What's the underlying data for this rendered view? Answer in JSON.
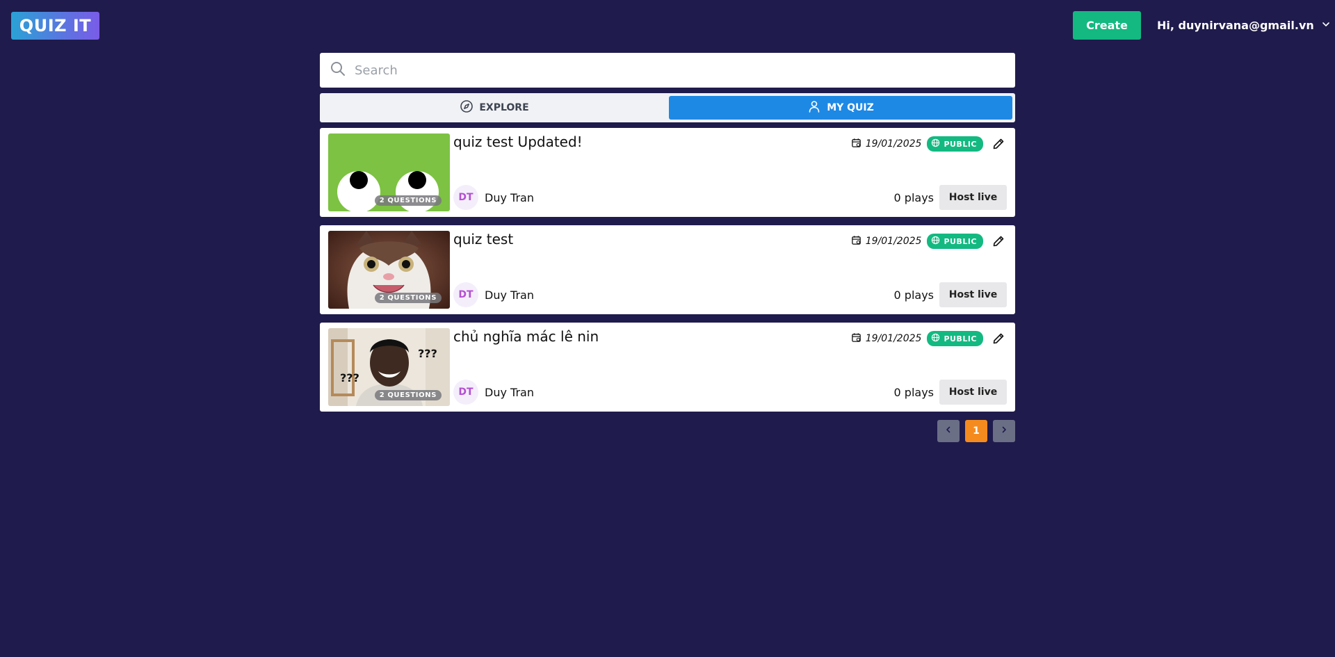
{
  "header": {
    "logo_text": "QUIZ IT",
    "create_label": "Create",
    "greeting": "Hi, duynirvana@gmail.vn"
  },
  "search": {
    "placeholder": "Search",
    "value": ""
  },
  "tabs": [
    {
      "label": "EXPLORE",
      "icon": "compass-icon",
      "active": false
    },
    {
      "label": "MY QUIZ",
      "icon": "user-icon",
      "active": true
    }
  ],
  "quizzes": [
    {
      "title": "quiz test Updated!",
      "date": "19/01/2025",
      "visibility": "PUBLIC",
      "questions_badge": "2 QUESTIONS",
      "author_initials": "DT",
      "author_name": "Duy Tran",
      "plays": "0 plays",
      "host_label": "Host live",
      "thumbnail": "green-eyes-cartoon"
    },
    {
      "title": "quiz test",
      "date": "19/01/2025",
      "visibility": "PUBLIC",
      "questions_badge": "2 QUESTIONS",
      "author_initials": "DT",
      "author_name": "Duy Tran",
      "plays": "0 plays",
      "host_label": "Host live",
      "thumbnail": "smiling-cat-photo"
    },
    {
      "title": "chủ nghĩa mác lê nin",
      "date": "19/01/2025",
      "visibility": "PUBLIC",
      "questions_badge": "2 QUESTIONS",
      "author_initials": "DT",
      "author_name": "Duy Tran",
      "plays": "0 plays",
      "host_label": "Host live",
      "thumbnail": "confused-man-meme",
      "thumbnail_text": "???"
    }
  ],
  "pagination": {
    "current_page": "1"
  },
  "colors": {
    "background": "#1f1b4c",
    "create_button": "#13b981",
    "active_tab": "#1e88e5",
    "public_badge": "#13b981",
    "current_page": "#f58b1f",
    "avatar_text": "#b44fd1"
  }
}
